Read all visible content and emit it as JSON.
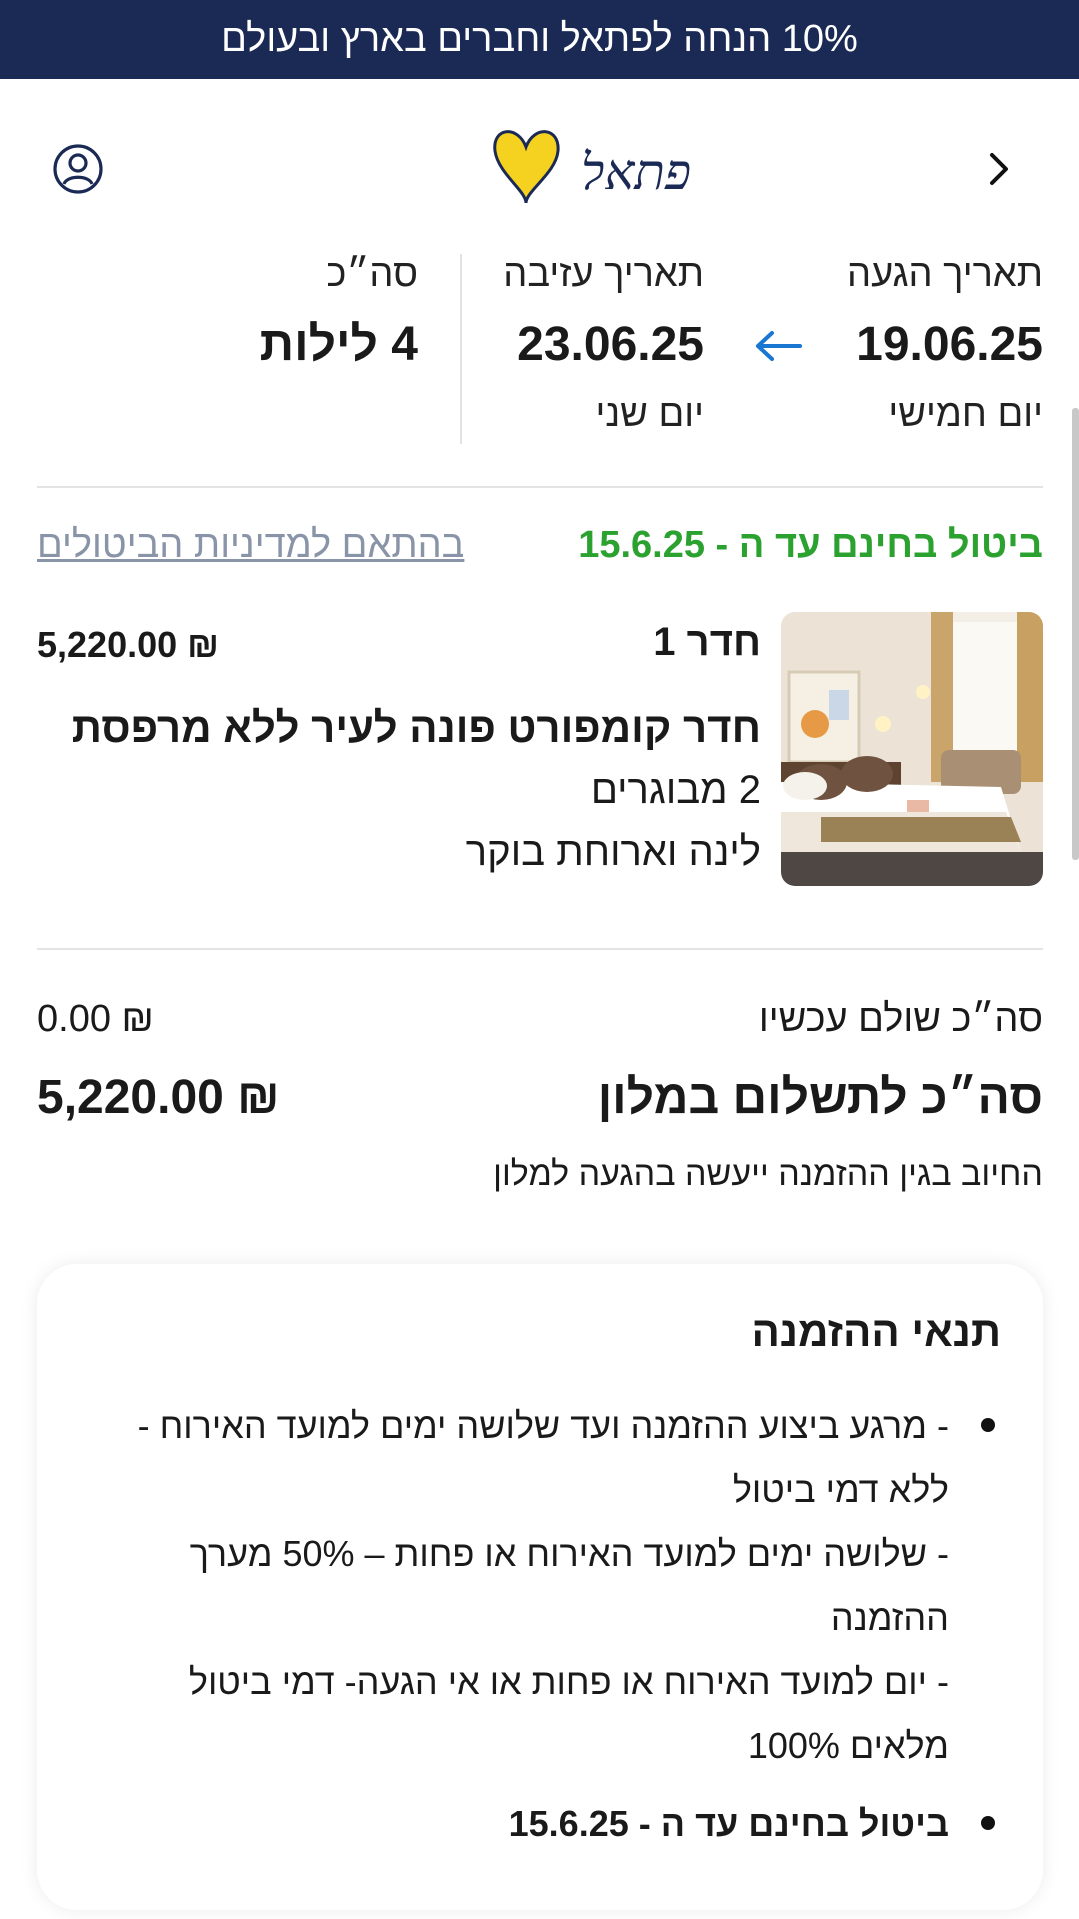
{
  "promo_banner": {
    "text": "10% הנחה לפתאל וחברים בארץ ובעולם"
  },
  "header": {
    "logo_text": "fattal",
    "logo_text_he": "פתאל"
  },
  "dates": {
    "arrival_label": "תאריך הגעה",
    "arrival_date": "19.06.25",
    "arrival_day": "יום חמישי",
    "departure_label": "תאריך עזיבה",
    "departure_date": "23.06.25",
    "departure_day": "יום שני",
    "total_label": "סה״כ",
    "total_nights": "4 לילות"
  },
  "cancellation": {
    "free_until": "ביטול בחינם עד ה - 15.6.25",
    "policy_link": "בהתאם למדיניות הביטולים"
  },
  "room": {
    "number_label": "חדר 1",
    "price": "₪ 5,220.00",
    "name": "חדר קומפורט פונה לעיר ללא מרפסת",
    "guests": "2 מבוגרים",
    "board": "לינה וארוחת בוקר"
  },
  "summary": {
    "paid_now_label": "סה״כ שולם עכשיו",
    "paid_now_value": "₪ 0.00",
    "hotel_pay_label": "סה״כ לתשלום במלון",
    "hotel_pay_value": "₪ 5,220.00",
    "charge_note": "החיוב בגין ההזמנה ייעשה בהגעה למלון"
  },
  "terms": {
    "title": "תנאי ההזמנה",
    "item1_line1": "- מרגע ביצוע ההזמנה ועד שלושה ימים למועד האירוח -",
    "item1_line2": "ללא דמי ביטול",
    "item1_line3": "- שלושה ימים למועד האירוח או פחות – 50% מערך",
    "item1_line4": "ההזמנה",
    "item1_line5": "- יום למועד האירוח או פחות או אי הגעה- דמי ביטול",
    "item1_line6": "מלאים 100%",
    "item2": "ביטול בחינם עד ה - 15.6.25"
  },
  "colors": {
    "banner_bg": "#1b2a55",
    "accent_blue": "#1976d2",
    "free_cancel_green": "#2ba12f",
    "logo_yellow": "#f5d21f",
    "logo_navy": "#1b2a55"
  }
}
